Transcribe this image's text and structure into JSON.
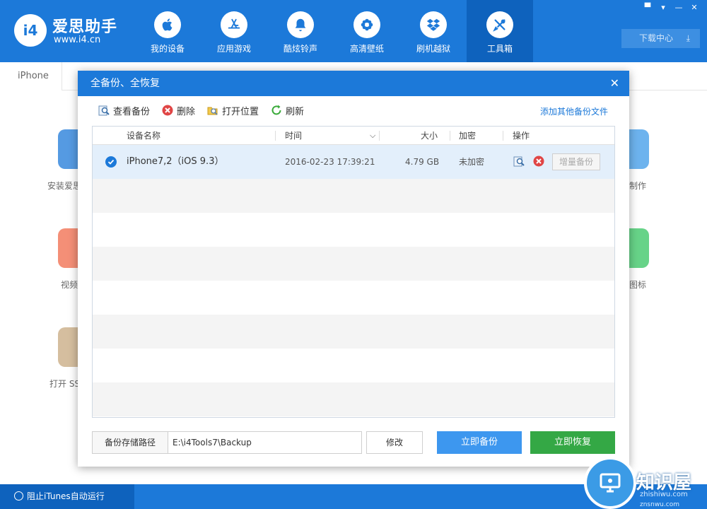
{
  "app": {
    "name": "爱思助手",
    "url": "www.i4.cn",
    "logo_glyph": "i4"
  },
  "nav": [
    {
      "label": "我的设备",
      "icon": "apple-icon"
    },
    {
      "label": "应用游戏",
      "icon": "app-store-icon"
    },
    {
      "label": "酷炫铃声",
      "icon": "bell-icon"
    },
    {
      "label": "高清壁纸",
      "icon": "flower-icon"
    },
    {
      "label": "刷机越狱",
      "icon": "dropbox-icon"
    },
    {
      "label": "工具箱",
      "icon": "tools-icon",
      "active": true
    }
  ],
  "window_controls": [
    "▀",
    "▾",
    "—",
    "✕"
  ],
  "download_center": {
    "label": "下载中心"
  },
  "device_tab": "iPhone",
  "background_tools": [
    {
      "label": "安装爱思",
      "color": "#1c79d9"
    },
    {
      "label": "视频",
      "color": "#f06a4a"
    },
    {
      "label": "打开 SSH",
      "color": "#c7a97f"
    },
    {
      "label": "制作",
      "color": "#3d9ae8"
    },
    {
      "label": "旋图标",
      "color": "#34c460"
    }
  ],
  "footer": {
    "itunes_label": "阻止iTunes自动运行"
  },
  "watermark": {
    "brand": "知识屋",
    "sub1": "zhishiwu.com",
    "sub2": "znsnwu.com"
  },
  "modal": {
    "title": "全备份、全恢复",
    "toolbar": {
      "view": "查看备份",
      "delete": "删除",
      "open_location": "打开位置",
      "refresh": "刷新"
    },
    "add_link": "添加其他备份文件",
    "columns": {
      "name": "设备名称",
      "time": "时间",
      "size": "大小",
      "encrypt": "加密",
      "action": "操作"
    },
    "rows": [
      {
        "name": "iPhone7,2（iOS 9.3）",
        "time": "2016-02-23 17:39:21",
        "size": "4.79 GB",
        "encrypt": "未加密",
        "incremental": "增量备份"
      }
    ],
    "path_label": "备份存储路径",
    "path_value": "E:\\i4Tools7\\Backup",
    "modify": "修改",
    "backup_now": "立即备份",
    "restore_now": "立即恢复"
  }
}
